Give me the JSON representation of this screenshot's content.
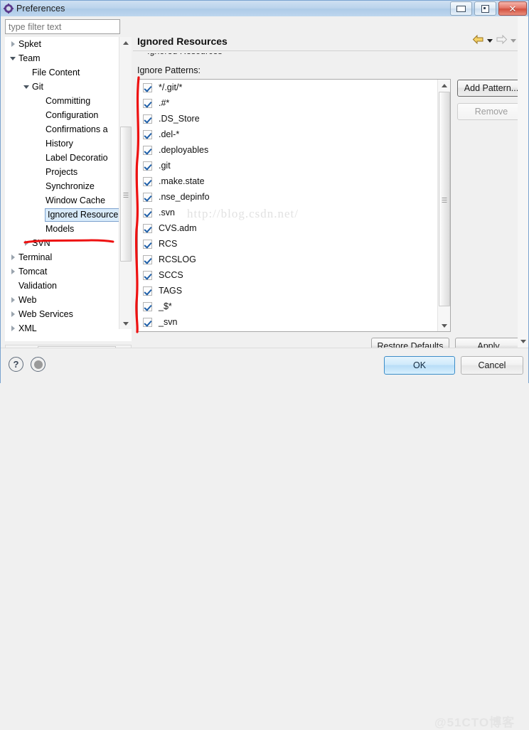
{
  "window": {
    "title": "Preferences",
    "icon": "preferences-icon",
    "controls": {
      "minimize": "minimize-button",
      "maximize": "maximize-button",
      "close": "close-button",
      "close_glyph": "✕"
    }
  },
  "filter": {
    "placeholder": "type filter text",
    "value": ""
  },
  "tree": {
    "items": [
      {
        "label": "Spket",
        "indent": 0,
        "twisty": "collapsed",
        "selected": false
      },
      {
        "label": "Team",
        "indent": 0,
        "twisty": "expanded",
        "selected": false
      },
      {
        "label": "File Content",
        "indent": 1,
        "twisty": "none",
        "selected": false
      },
      {
        "label": "Git",
        "indent": 1,
        "twisty": "expanded",
        "selected": false
      },
      {
        "label": "Committing",
        "indent": 2,
        "twisty": "none",
        "selected": false
      },
      {
        "label": "Configuration",
        "indent": 2,
        "twisty": "none",
        "selected": false
      },
      {
        "label": "Confirmations a",
        "indent": 2,
        "twisty": "none",
        "selected": false
      },
      {
        "label": "History",
        "indent": 2,
        "twisty": "none",
        "selected": false
      },
      {
        "label": "Label Decoratio",
        "indent": 2,
        "twisty": "none",
        "selected": false
      },
      {
        "label": "Projects",
        "indent": 2,
        "twisty": "none",
        "selected": false
      },
      {
        "label": "Synchronize",
        "indent": 2,
        "twisty": "none",
        "selected": false
      },
      {
        "label": "Window Cache",
        "indent": 2,
        "twisty": "none",
        "selected": false
      },
      {
        "label": "Ignored Resource",
        "indent": 2,
        "twisty": "none",
        "selected": true
      },
      {
        "label": "Models",
        "indent": 2,
        "twisty": "none",
        "selected": false
      },
      {
        "label": "SVN",
        "indent": 1,
        "twisty": "collapsed",
        "selected": false
      },
      {
        "label": "Terminal",
        "indent": 0,
        "twisty": "collapsed",
        "selected": false
      },
      {
        "label": "Tomcat",
        "indent": 0,
        "twisty": "collapsed",
        "selected": false
      },
      {
        "label": "Validation",
        "indent": 0,
        "twisty": "none",
        "selected": false
      },
      {
        "label": "Web",
        "indent": 0,
        "twisty": "collapsed",
        "selected": false
      },
      {
        "label": "Web Services",
        "indent": 0,
        "twisty": "collapsed",
        "selected": false
      },
      {
        "label": "XML",
        "indent": 0,
        "twisty": "collapsed",
        "selected": false
      }
    ]
  },
  "pane": {
    "title": "Ignored Resources",
    "clipped_text": "Ignored Resources",
    "patterns_label": "Ignore Patterns:",
    "nav": {
      "back": "back-arrow-icon",
      "forward": "forward-arrow-icon"
    }
  },
  "patterns": [
    {
      "label": "*/.git/*",
      "checked": true
    },
    {
      "label": ".#*",
      "checked": true
    },
    {
      "label": ".DS_Store",
      "checked": true
    },
    {
      "label": ".del-*",
      "checked": true
    },
    {
      "label": ".deployables",
      "checked": true
    },
    {
      "label": ".git",
      "checked": true
    },
    {
      "label": ".make.state",
      "checked": true
    },
    {
      "label": ".nse_depinfo",
      "checked": true
    },
    {
      "label": ".svn",
      "checked": true
    },
    {
      "label": "CVS.adm",
      "checked": true
    },
    {
      "label": "RCS",
      "checked": true
    },
    {
      "label": "RCSLOG",
      "checked": true
    },
    {
      "label": "SCCS",
      "checked": true
    },
    {
      "label": "TAGS",
      "checked": true
    },
    {
      "label": "_$*",
      "checked": true
    },
    {
      "label": "_svn",
      "checked": true
    }
  ],
  "buttons": {
    "add_pattern": "Add Pattern...",
    "remove": "Remove",
    "restore_defaults": "Restore Defaults",
    "apply": "Apply",
    "ok": "OK",
    "cancel": "Cancel"
  },
  "footer": {
    "help_glyph": "?",
    "help_name": "help-icon",
    "dot_name": "status-dot-icon"
  },
  "watermarks": {
    "blog": "http://blog.csdn.net/",
    "cto": "@51CTO博客"
  },
  "colors": {
    "titlebar": "#bcd4ec",
    "selection": "#d9ebfb",
    "accent": "#3c8dc8",
    "annotation_red": "#ee1111",
    "close_red": "#d2513f"
  }
}
